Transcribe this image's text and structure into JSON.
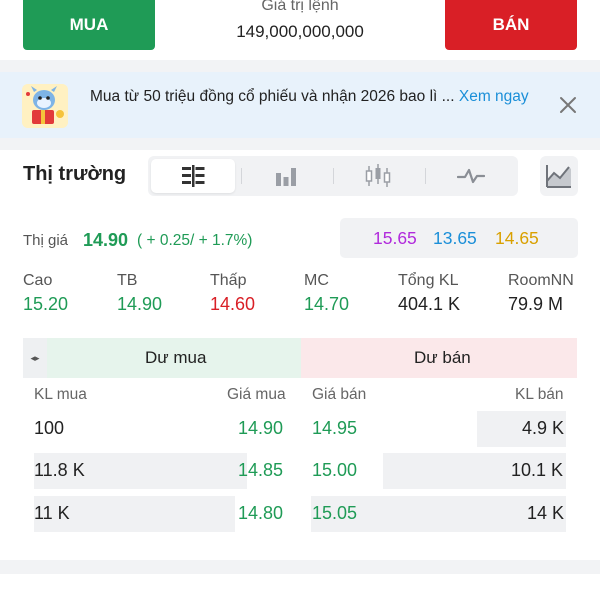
{
  "top_bar": {
    "buy_label": "MUA",
    "sell_label": "BÁN",
    "order_value_label": "Giá trị lệnh",
    "order_value": "149,000,000,000"
  },
  "promo": {
    "text": "Mua từ 50 triệu đồng cổ phiếu và nhận 2026 bao lì ... ",
    "link": "Xem ngay",
    "icon": "mascot-icon",
    "close_icon": "close-icon"
  },
  "market": {
    "title": "Thị trường",
    "tabs": [
      "order-book-icon",
      "bar-chart-icon",
      "candlestick-icon",
      "line-pulse-icon"
    ],
    "chart_icon": "chart-area-icon"
  },
  "price": {
    "label": "Thị giá",
    "value": "14.90",
    "change": "( + 0.25/ + 1.7%)",
    "ceiling": "15.65",
    "floor": "13.65",
    "reference": "14.65"
  },
  "stats": [
    {
      "label": "Cao",
      "value": "15.20",
      "color": "#1f9b56"
    },
    {
      "label": "TB",
      "value": "14.90",
      "color": "#1f9b56"
    },
    {
      "label": "Thấp",
      "value": "14.60",
      "color": "#d91f26"
    },
    {
      "label": "MC",
      "value": "14.70",
      "color": "#1f9b56"
    },
    {
      "label": "Tổng KL",
      "value": "404.1 K",
      "color": "#222222"
    },
    {
      "label": "RoomNN",
      "value": "79.9 M",
      "color": "#222222"
    }
  ],
  "order_book": {
    "buy_header": "Dư mua",
    "sell_header": "Dư bán",
    "col_buy_vol": "KL mua",
    "col_buy_price": "Giá mua",
    "col_sell_price": "Giá bán",
    "col_sell_vol": "KL bán",
    "rows": [
      {
        "buy_vol": "100",
        "buy_price": "14.90",
        "sell_price": "14.95",
        "sell_vol": "4.9 K"
      },
      {
        "buy_vol": "11.8 K",
        "buy_price": "14.85",
        "sell_price": "15.00",
        "sell_vol": "10.1 K"
      },
      {
        "buy_vol": "11 K",
        "buy_price": "14.80",
        "sell_price": "15.05",
        "sell_vol": "14 K"
      }
    ]
  },
  "colors": {
    "buy": "#1f9b56",
    "sell": "#d91f26",
    "ceiling": "#b12adc",
    "floor": "#1b8fd8",
    "reference": "#d9a000"
  }
}
